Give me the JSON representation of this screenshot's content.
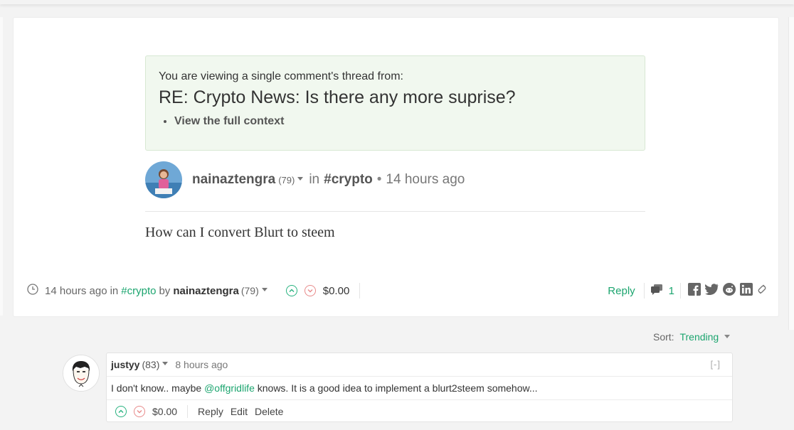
{
  "callout": {
    "pre_text": "You are viewing a single comment's thread from:",
    "title": "RE: Crypto News: Is there any more suprise?",
    "link": "View the full context"
  },
  "post": {
    "author": "nainaztengra",
    "reputation": "(79)",
    "in_word": "in",
    "tag": "#crypto",
    "separator": "•",
    "time": "14 hours ago",
    "body": "How can I convert Blurt to steem"
  },
  "footer": {
    "time": "14 hours ago",
    "in_word": "in",
    "tag": "#crypto",
    "by_word": "by",
    "author": "nainaztengra",
    "reputation": "(79)",
    "payout": "$0.00",
    "reply": "Reply",
    "comment_count": "1"
  },
  "sort": {
    "label": "Sort:",
    "value": "Trending"
  },
  "comment": {
    "author": "justyy",
    "reputation": "(83)",
    "time": "8 hours ago",
    "collapse": "[-]",
    "text_before": "I don't know.. maybe ",
    "mention": "@offgridlife",
    "text_after": " knows. It is a good idea to implement a blurt2steem somehow...",
    "payout": "$0.00",
    "reply": "Reply",
    "edit": "Edit",
    "delete": "Delete"
  },
  "colors": {
    "accent_green": "#1ca56f",
    "callout_bg": "#f1f8ef",
    "downvote_red": "#e88a8a"
  },
  "icons": [
    "clock-icon",
    "upvote-icon",
    "downvote-icon",
    "comments-icon",
    "facebook-icon",
    "twitter-icon",
    "reddit-icon",
    "linkedin-icon",
    "link-icon",
    "caret-down-icon"
  ]
}
